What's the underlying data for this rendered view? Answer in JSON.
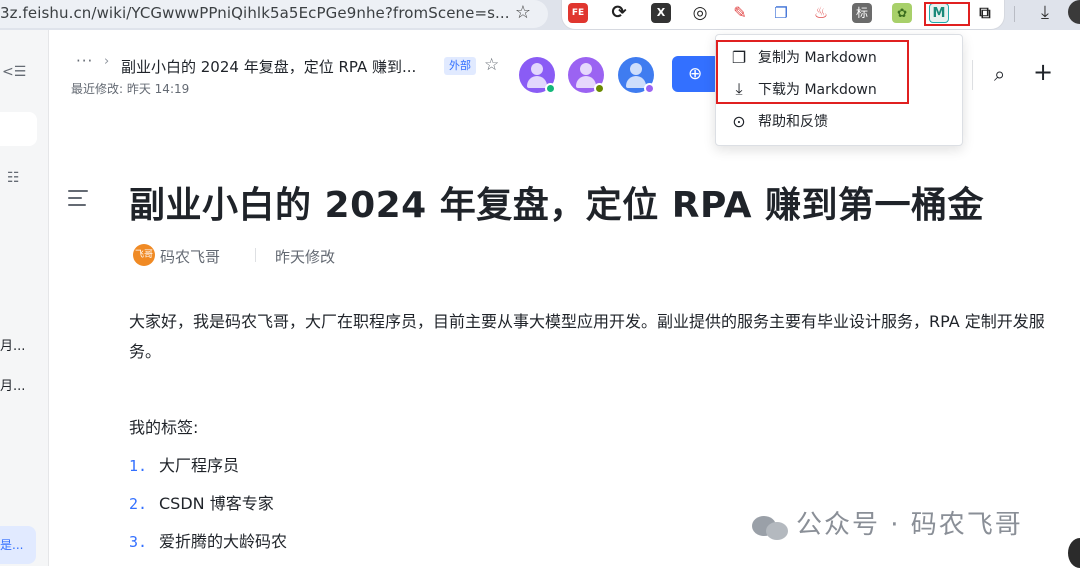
{
  "browser": {
    "url": "3z.feishu.cn/wiki/YCGwwwPPniQihlk5a5EcPGe9nhe?fromScene=s...",
    "extensions": {
      "fe": "FE",
      "x": "X",
      "biao": "标",
      "md": "M"
    }
  },
  "sidebar": {
    "items": [
      {
        "label": "月..."
      },
      {
        "label": "月..."
      },
      {
        "label": "是..."
      }
    ]
  },
  "header": {
    "more": "···",
    "doc_title": "副业小白的 2024 年复盘，定位 RPA 赚到...",
    "external_badge": "外部",
    "last_modified": "最近修改: 昨天 14:19"
  },
  "menu": {
    "items": [
      {
        "label": "复制为 Markdown",
        "icon": "copy-icon"
      },
      {
        "label": "下载为 Markdown",
        "icon": "download-icon"
      },
      {
        "label": "帮助和反馈",
        "icon": "help-icon"
      }
    ]
  },
  "doc": {
    "title": "副业小白的 2024 年复盘，定位 RPA 赚到第一桶金",
    "author_avatar_text": "飞哥",
    "author": "码农飞哥",
    "updated": "昨天修改",
    "intro": "大家好，我是码农飞哥，大厂在职程序员，目前主要从事大模型应用开发。副业提供的服务主要有毕业设计服务，RPA 定制开发服务。",
    "tags_label": "我的标签:",
    "tags": [
      {
        "num": "1.",
        "text": "大厂程序员"
      },
      {
        "num": "2.",
        "text": "CSDN 博客专家"
      },
      {
        "num": "3.",
        "text": "爱折腾的大龄码农"
      }
    ]
  },
  "watermark": {
    "text": "公众号 · 码农飞哥"
  },
  "colors": {
    "accent": "#3370ff",
    "highlight_box": "#e02020"
  }
}
